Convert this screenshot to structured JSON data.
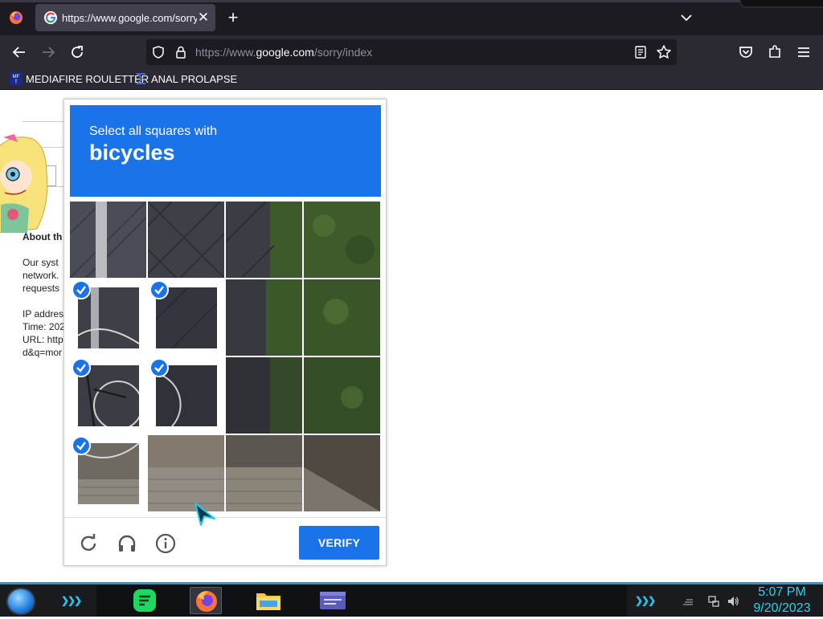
{
  "browser": {
    "tab": {
      "title": "https://www.google.com/sorry/index"
    },
    "url": {
      "prefix": "https://www.",
      "domain": "google.com",
      "path": "/sorry/index"
    },
    "bookmarks": [
      {
        "label": "MEDIAFIRE ROULETTER",
        "icon": "mft-icon"
      },
      {
        "label": "ANAL PROLAPSE",
        "icon": "sigma-icon"
      }
    ]
  },
  "page": {
    "heading": "About th",
    "lines": [
      "Our syst",
      "network.",
      "requests"
    ],
    "info_lines": [
      "IP addres",
      "Time: 202",
      "URL: http",
      "d&q=mor"
    ]
  },
  "captcha": {
    "instruction": "Select all squares with",
    "target": "bicycles",
    "selected_tiles": [
      4,
      5,
      8,
      9,
      12
    ],
    "verify_label": "VERIFY",
    "accent": "#1a73e8"
  },
  "taskbar": {
    "time": "5:07 PM",
    "date": "9/20/2023",
    "accent": "#2ad4e8"
  }
}
